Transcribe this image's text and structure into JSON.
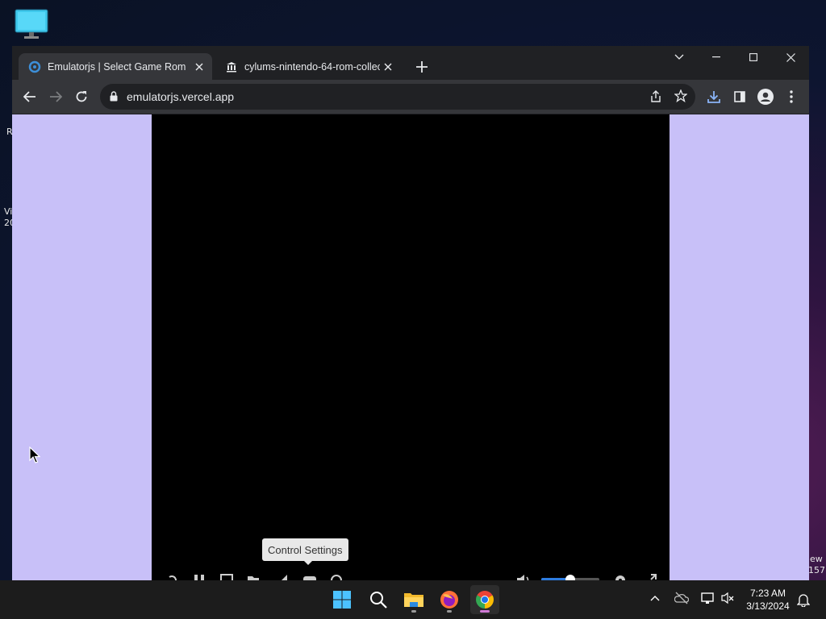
{
  "desktop": {
    "side_text_1": "R",
    "side_text_2": "Vi",
    "side_text_3": "20",
    "right_text_1": "ew",
    "right_text_2": "157"
  },
  "browser": {
    "tabs": [
      {
        "title": "Emulatorjs | Select Game Rom",
        "active": true,
        "favicon": "emulatorjs-icon"
      },
      {
        "title": "cylums-nintendo-64-rom-collect",
        "active": false,
        "favicon": "archive-icon"
      }
    ],
    "url": "emulatorjs.vercel.app",
    "accent_color": "#8ab4f8"
  },
  "page": {
    "background_color": "#c8c0f8",
    "tooltip": "Control Settings"
  },
  "taskbar": {
    "apps": [
      "windows-start-icon",
      "search-icon",
      "file-explorer-icon",
      "firefox-icon",
      "chrome-icon"
    ],
    "time": "7:23 AM",
    "date": "3/13/2024"
  }
}
